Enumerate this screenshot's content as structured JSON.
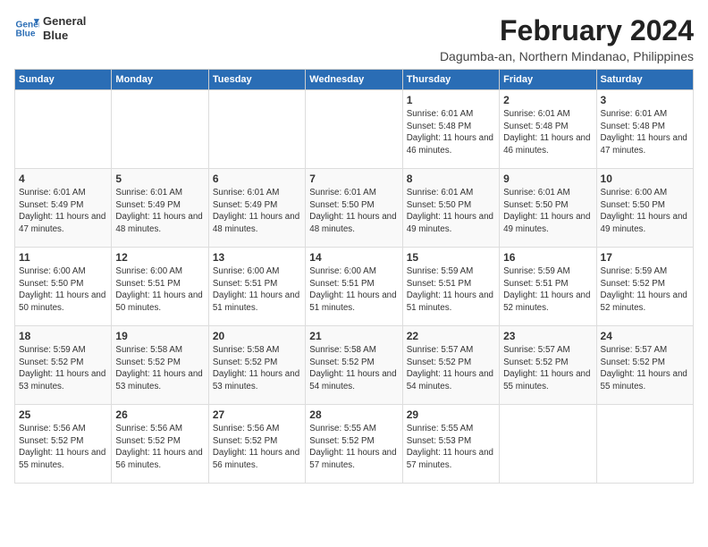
{
  "logo": {
    "line1": "General",
    "line2": "Blue"
  },
  "title": "February 2024",
  "subtitle": "Dagumba-an, Northern Mindanao, Philippines",
  "columns": [
    "Sunday",
    "Monday",
    "Tuesday",
    "Wednesday",
    "Thursday",
    "Friday",
    "Saturday"
  ],
  "weeks": [
    [
      {
        "day": "",
        "text": ""
      },
      {
        "day": "",
        "text": ""
      },
      {
        "day": "",
        "text": ""
      },
      {
        "day": "",
        "text": ""
      },
      {
        "day": "1",
        "text": "Sunrise: 6:01 AM\nSunset: 5:48 PM\nDaylight: 11 hours and 46 minutes."
      },
      {
        "day": "2",
        "text": "Sunrise: 6:01 AM\nSunset: 5:48 PM\nDaylight: 11 hours and 46 minutes."
      },
      {
        "day": "3",
        "text": "Sunrise: 6:01 AM\nSunset: 5:48 PM\nDaylight: 11 hours and 47 minutes."
      }
    ],
    [
      {
        "day": "4",
        "text": "Sunrise: 6:01 AM\nSunset: 5:49 PM\nDaylight: 11 hours and 47 minutes."
      },
      {
        "day": "5",
        "text": "Sunrise: 6:01 AM\nSunset: 5:49 PM\nDaylight: 11 hours and 48 minutes."
      },
      {
        "day": "6",
        "text": "Sunrise: 6:01 AM\nSunset: 5:49 PM\nDaylight: 11 hours and 48 minutes."
      },
      {
        "day": "7",
        "text": "Sunrise: 6:01 AM\nSunset: 5:50 PM\nDaylight: 11 hours and 48 minutes."
      },
      {
        "day": "8",
        "text": "Sunrise: 6:01 AM\nSunset: 5:50 PM\nDaylight: 11 hours and 49 minutes."
      },
      {
        "day": "9",
        "text": "Sunrise: 6:01 AM\nSunset: 5:50 PM\nDaylight: 11 hours and 49 minutes."
      },
      {
        "day": "10",
        "text": "Sunrise: 6:00 AM\nSunset: 5:50 PM\nDaylight: 11 hours and 49 minutes."
      }
    ],
    [
      {
        "day": "11",
        "text": "Sunrise: 6:00 AM\nSunset: 5:50 PM\nDaylight: 11 hours and 50 minutes."
      },
      {
        "day": "12",
        "text": "Sunrise: 6:00 AM\nSunset: 5:51 PM\nDaylight: 11 hours and 50 minutes."
      },
      {
        "day": "13",
        "text": "Sunrise: 6:00 AM\nSunset: 5:51 PM\nDaylight: 11 hours and 51 minutes."
      },
      {
        "day": "14",
        "text": "Sunrise: 6:00 AM\nSunset: 5:51 PM\nDaylight: 11 hours and 51 minutes."
      },
      {
        "day": "15",
        "text": "Sunrise: 5:59 AM\nSunset: 5:51 PM\nDaylight: 11 hours and 51 minutes."
      },
      {
        "day": "16",
        "text": "Sunrise: 5:59 AM\nSunset: 5:51 PM\nDaylight: 11 hours and 52 minutes."
      },
      {
        "day": "17",
        "text": "Sunrise: 5:59 AM\nSunset: 5:52 PM\nDaylight: 11 hours and 52 minutes."
      }
    ],
    [
      {
        "day": "18",
        "text": "Sunrise: 5:59 AM\nSunset: 5:52 PM\nDaylight: 11 hours and 53 minutes."
      },
      {
        "day": "19",
        "text": "Sunrise: 5:58 AM\nSunset: 5:52 PM\nDaylight: 11 hours and 53 minutes."
      },
      {
        "day": "20",
        "text": "Sunrise: 5:58 AM\nSunset: 5:52 PM\nDaylight: 11 hours and 53 minutes."
      },
      {
        "day": "21",
        "text": "Sunrise: 5:58 AM\nSunset: 5:52 PM\nDaylight: 11 hours and 54 minutes."
      },
      {
        "day": "22",
        "text": "Sunrise: 5:57 AM\nSunset: 5:52 PM\nDaylight: 11 hours and 54 minutes."
      },
      {
        "day": "23",
        "text": "Sunrise: 5:57 AM\nSunset: 5:52 PM\nDaylight: 11 hours and 55 minutes."
      },
      {
        "day": "24",
        "text": "Sunrise: 5:57 AM\nSunset: 5:52 PM\nDaylight: 11 hours and 55 minutes."
      }
    ],
    [
      {
        "day": "25",
        "text": "Sunrise: 5:56 AM\nSunset: 5:52 PM\nDaylight: 11 hours and 55 minutes."
      },
      {
        "day": "26",
        "text": "Sunrise: 5:56 AM\nSunset: 5:52 PM\nDaylight: 11 hours and 56 minutes."
      },
      {
        "day": "27",
        "text": "Sunrise: 5:56 AM\nSunset: 5:52 PM\nDaylight: 11 hours and 56 minutes."
      },
      {
        "day": "28",
        "text": "Sunrise: 5:55 AM\nSunset: 5:52 PM\nDaylight: 11 hours and 57 minutes."
      },
      {
        "day": "29",
        "text": "Sunrise: 5:55 AM\nSunset: 5:53 PM\nDaylight: 11 hours and 57 minutes."
      },
      {
        "day": "",
        "text": ""
      },
      {
        "day": "",
        "text": ""
      }
    ]
  ]
}
